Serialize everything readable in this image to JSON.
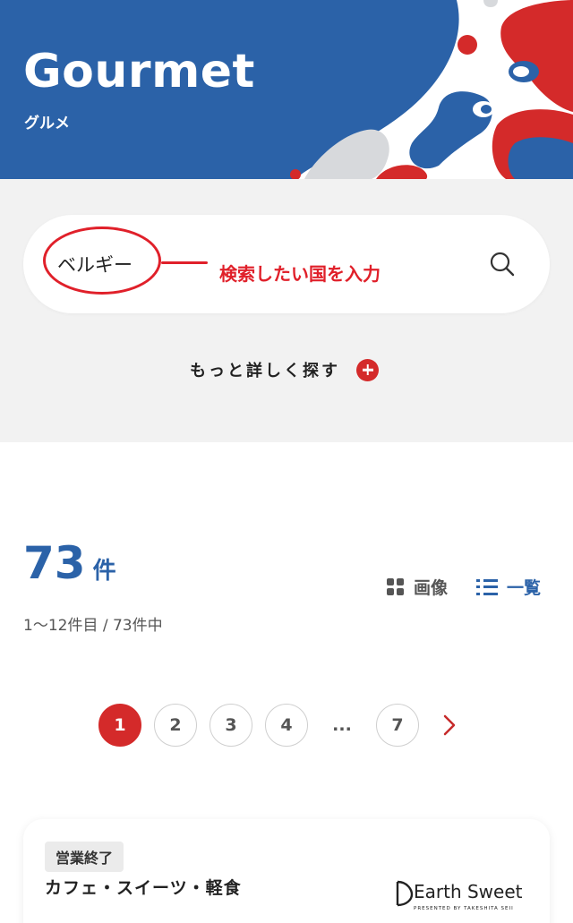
{
  "header": {
    "title": "Gourmet",
    "subtitle": "グルメ"
  },
  "search": {
    "value": "ベルギー",
    "placeholder": "",
    "annotation": "検索したい国を入力",
    "more_label": "もっと詳しく探す"
  },
  "results": {
    "count": "73",
    "count_unit": "件",
    "range_text": "1～12件目 / 73件中",
    "view_image_label": "画像",
    "view_list_label": "一覧"
  },
  "pagination": {
    "pages": [
      "1",
      "2",
      "3",
      "4"
    ],
    "ellipsis": "...",
    "last": "7",
    "current": "1"
  },
  "card": {
    "status": "営業終了",
    "category": "カフェ・スイーツ・軽食",
    "logo_text": "Earth Sweet",
    "logo_subtext": "PRESENTED BY TAKESHITA SEII"
  },
  "colors": {
    "brand_blue": "#2b62a8",
    "accent_red": "#d42a2a",
    "annotation_red": "#e0202a",
    "search_bg": "#f2f2f2"
  }
}
